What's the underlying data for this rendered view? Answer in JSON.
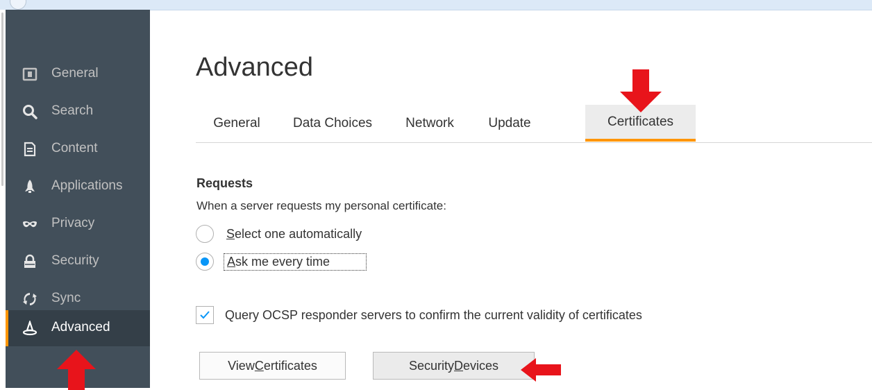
{
  "sidebar": {
    "items": [
      {
        "label": "General",
        "icon": "general-icon"
      },
      {
        "label": "Search",
        "icon": "search-icon"
      },
      {
        "label": "Content",
        "icon": "content-icon"
      },
      {
        "label": "Applications",
        "icon": "applications-icon"
      },
      {
        "label": "Privacy",
        "icon": "privacy-mask-icon"
      },
      {
        "label": "Security",
        "icon": "security-lock-icon"
      },
      {
        "label": "Sync",
        "icon": "sync-icon"
      },
      {
        "label": "Advanced",
        "icon": "advanced-wizard-hat-icon",
        "active": true
      }
    ]
  },
  "page": {
    "title": "Advanced"
  },
  "tabs": [
    {
      "label": "General"
    },
    {
      "label": "Data Choices"
    },
    {
      "label": "Network"
    },
    {
      "label": "Update"
    },
    {
      "label": "Certificates",
      "selected": true
    }
  ],
  "requests": {
    "heading": "Requests",
    "description": "When a server requests my personal certificate:",
    "option_auto": {
      "accesskey": "S",
      "rest": "elect one automatically",
      "checked": false
    },
    "option_ask": {
      "accesskey": "A",
      "rest": "sk me every time",
      "checked": true
    }
  },
  "ocsp": {
    "label": "Query OCSP responder servers to confirm the current validity of certificates",
    "checked": true
  },
  "buttons": {
    "view_pre": "View ",
    "view_key": "C",
    "view_post": "ertificates",
    "devices_pre": "Security ",
    "devices_key": "D",
    "devices_post": "evices"
  },
  "colors": {
    "sidebar_bg": "#424f5a",
    "sidebar_active_bg": "#343f48",
    "accent_orange": "#ff9500",
    "radio_blue": "#0996f8",
    "annotation_arrow": "#e8141b"
  }
}
